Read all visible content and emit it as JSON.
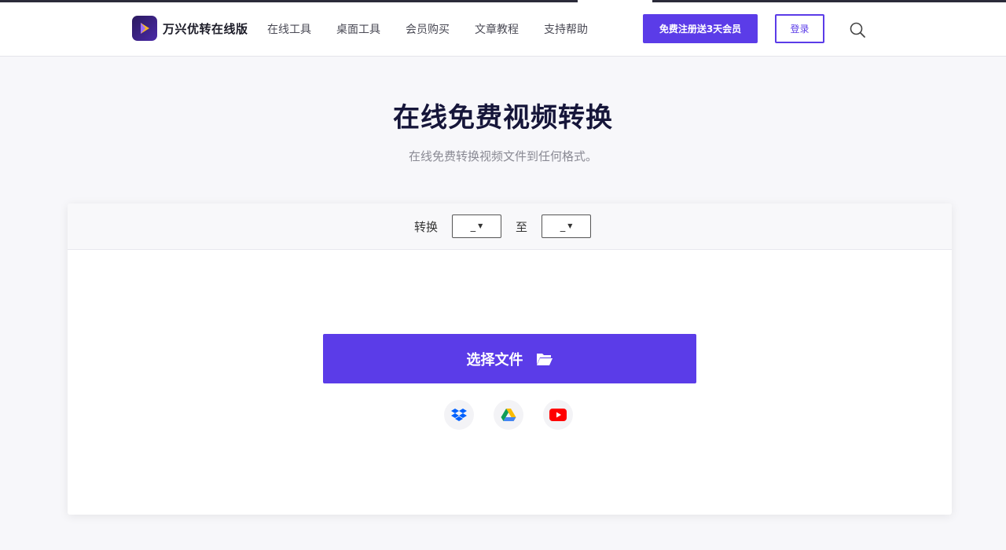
{
  "header": {
    "brand": "万兴优转在线版",
    "nav": [
      "在线工具",
      "桌面工具",
      "会员购买",
      "文章教程",
      "支持帮助"
    ],
    "register_label": "免费注册送3天会员",
    "login_label": "登录"
  },
  "main": {
    "title": "在线免费视频转换",
    "subtitle": "在线免费转换视频文件到任何格式。"
  },
  "converter": {
    "convert_label": "转换",
    "to_label": "至",
    "from_value": "_",
    "to_value": "_",
    "choose_file_label": "选择文件",
    "sources": [
      "dropbox-icon",
      "google-drive-icon",
      "youtube-icon"
    ]
  },
  "colors": {
    "accent": "#5b3ce8",
    "background": "#f7f7fa",
    "title": "#16163a"
  }
}
